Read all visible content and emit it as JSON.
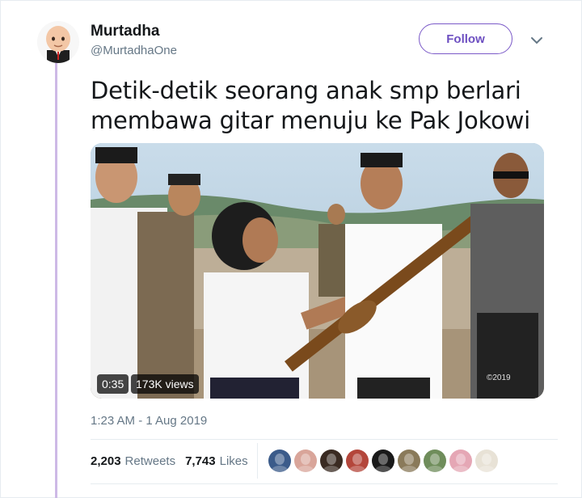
{
  "user": {
    "name": "Murtadha",
    "handle": "@MurtadhaOne",
    "avatar_icon": "boss-baby-avatar"
  },
  "actions": {
    "follow_label": "Follow",
    "menu_icon": "chevron-down-icon"
  },
  "tweet": {
    "text_line1": "Detik-detik seorang anak smp berlari",
    "text_line2": "membawa gitar menuju ke Pak Jokowi ..."
  },
  "video": {
    "duration": "0:35",
    "views": "173K views",
    "watermark": "©2019"
  },
  "meta": {
    "timestamp": "1:23 AM - 1 Aug 2019"
  },
  "stats": {
    "retweets_count": "2,203",
    "retweets_label": "Retweets",
    "likes_count": "7,743",
    "likes_label": "Likes"
  },
  "likers": [
    {
      "name": "liker-avatar-1",
      "color": "#3b5b8a"
    },
    {
      "name": "liker-avatar-2",
      "color": "#d9a59a"
    },
    {
      "name": "liker-avatar-3",
      "color": "#3a2b22"
    },
    {
      "name": "liker-avatar-4",
      "color": "#b4463b"
    },
    {
      "name": "liker-avatar-5",
      "color": "#1a1a1a"
    },
    {
      "name": "liker-avatar-6",
      "color": "#8a7a5a"
    },
    {
      "name": "liker-avatar-7",
      "color": "#6f8d5b"
    },
    {
      "name": "liker-avatar-8",
      "color": "#e5a7b5"
    },
    {
      "name": "liker-avatar-9",
      "color": "#e8e2d6"
    }
  ],
  "colors": {
    "accent": "#6d4fc1",
    "thread_line": "#cdb9e6",
    "secondary_text": "#657786"
  }
}
